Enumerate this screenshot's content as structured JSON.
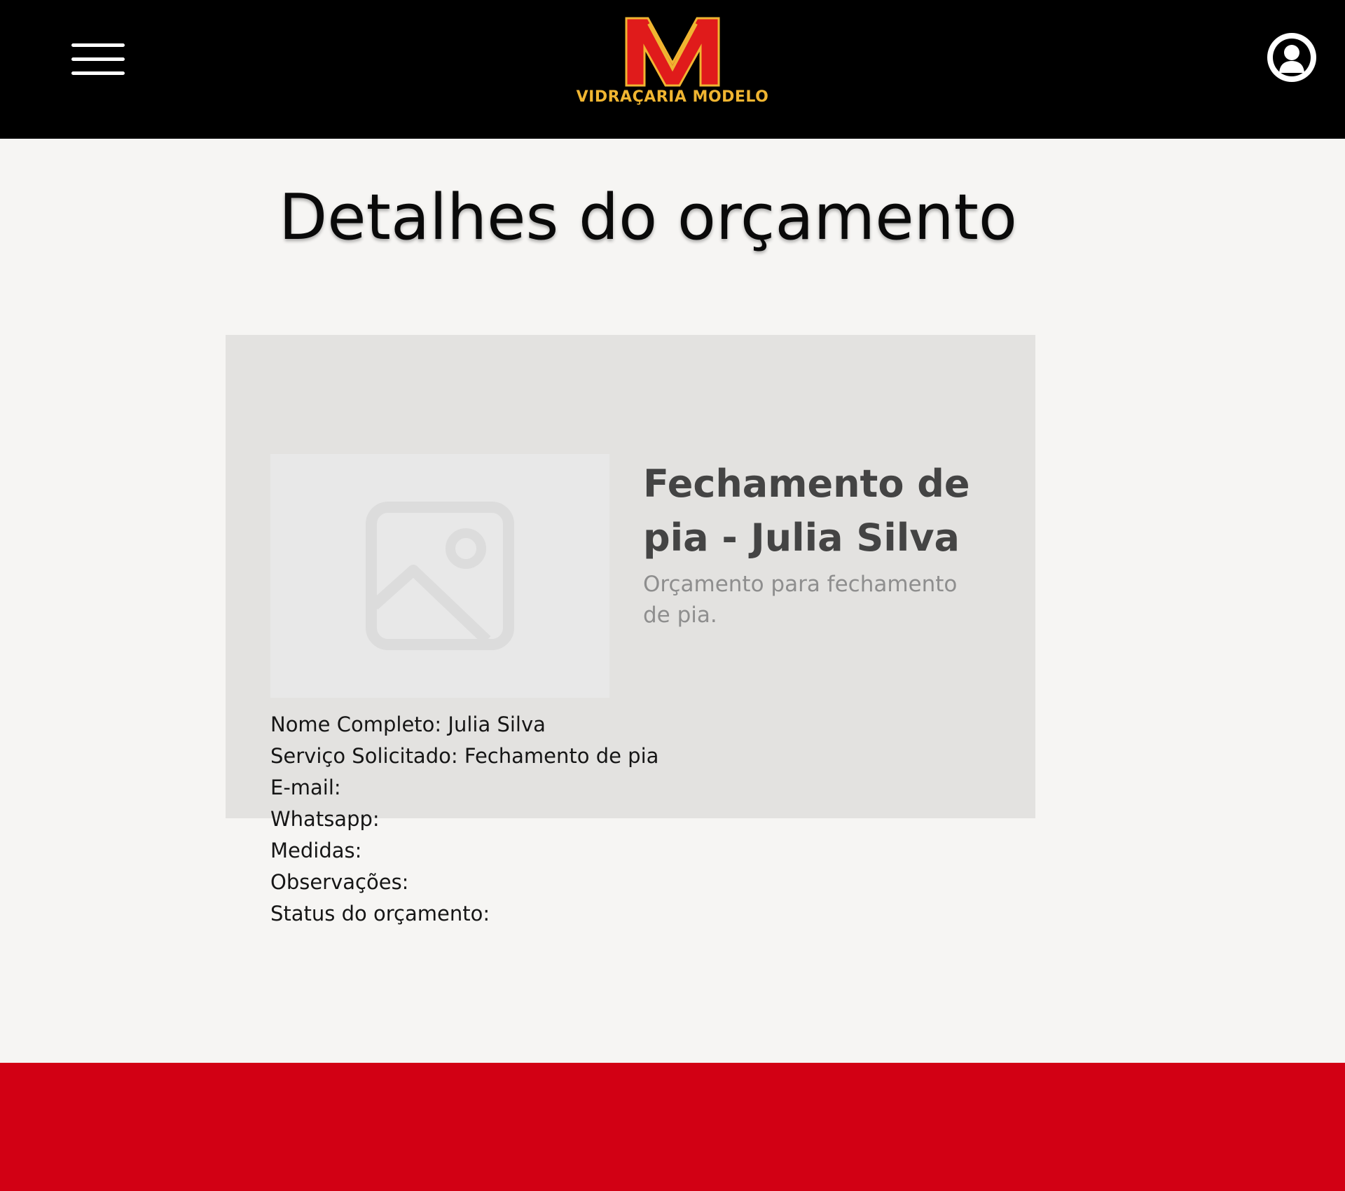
{
  "header": {
    "menu_icon": "hamburger-menu-icon",
    "logo": {
      "letter": "M",
      "text": "VIDRAÇARIA MODELO",
      "colors": {
        "red": "#e01b1b",
        "yellow": "#f0b531"
      }
    },
    "account_icon": "user-avatar-icon",
    "background": "#000000"
  },
  "main": {
    "title": "Detalhes do orçamento",
    "card": {
      "image_icon": "image-placeholder-icon",
      "service_title": "Fechamento de pia - Julia Silva",
      "service_description": "Orçamento para fechamento de pia.",
      "details": [
        {
          "label": "Nome Completo:",
          "value": "Julia Silva"
        },
        {
          "label": "Serviço Solicitado:",
          "value": "Fechamento de pia"
        },
        {
          "label": "E-mail:",
          "value": ""
        },
        {
          "label": "Whatsapp:",
          "value": ""
        },
        {
          "label": "Medidas:",
          "value": ""
        },
        {
          "label": "Observações:",
          "value": ""
        },
        {
          "label": "Status do orçamento:",
          "value": ""
        }
      ]
    }
  },
  "footer": {
    "background": "#d20014"
  }
}
